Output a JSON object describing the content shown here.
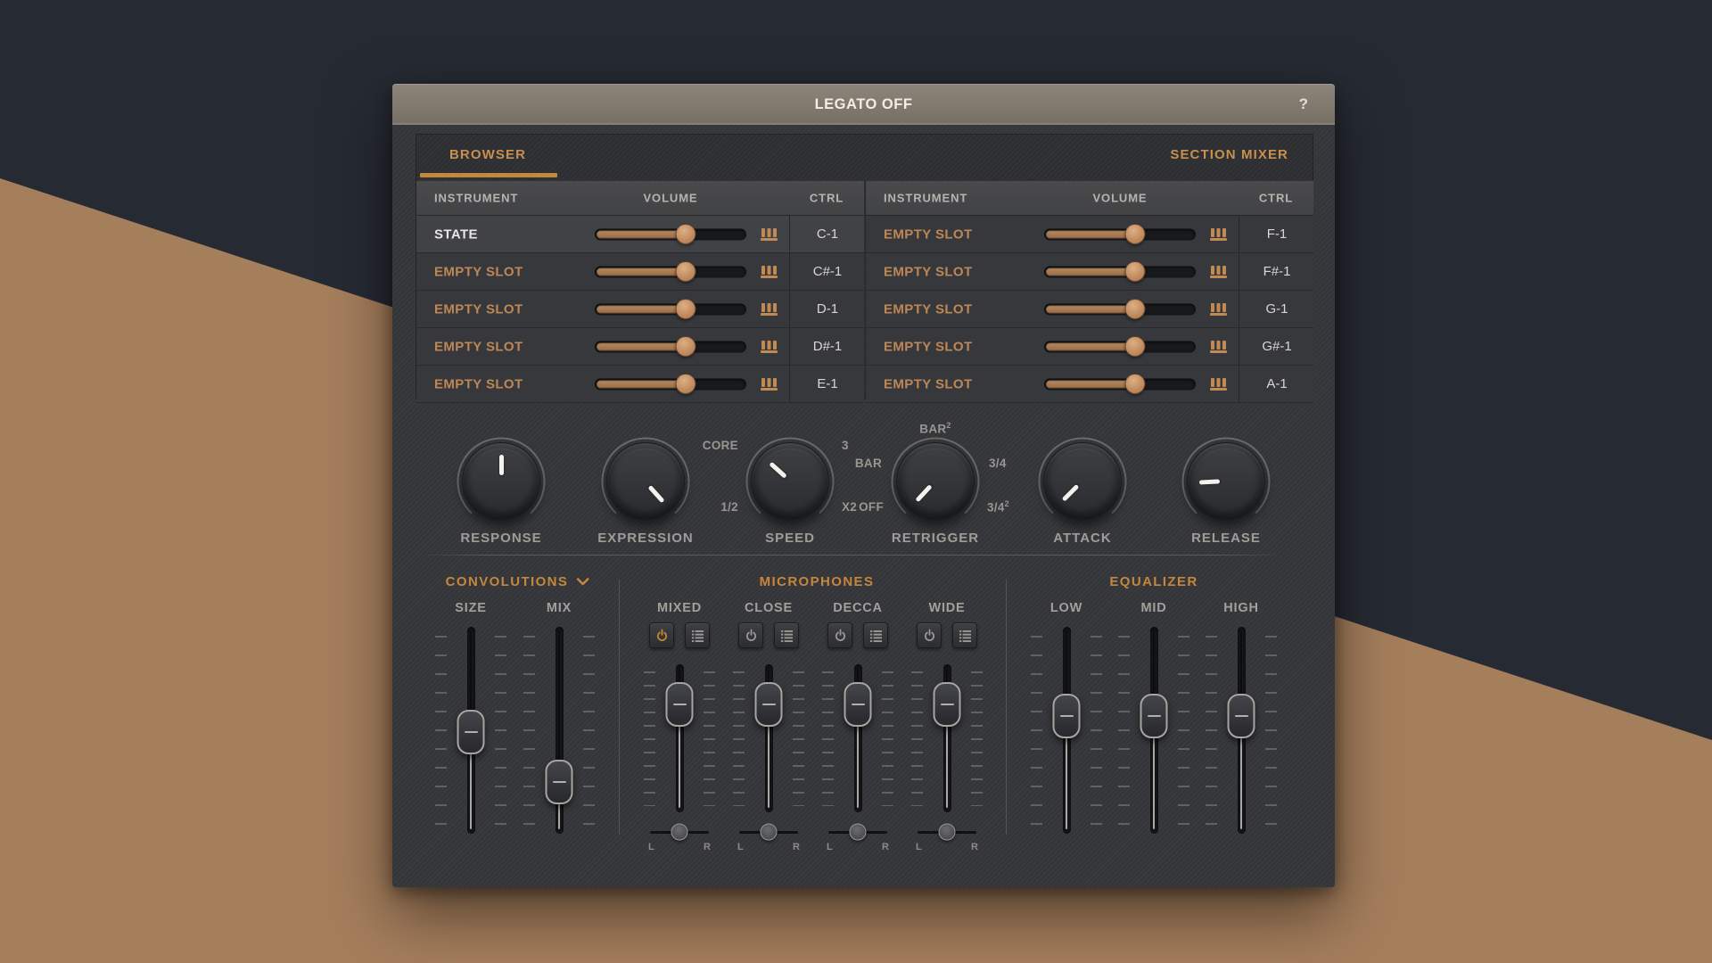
{
  "colors": {
    "accent_orange": "#C5873E",
    "empty_slot_orange": "#BE8757",
    "desktop_navy": "#262A32",
    "desktop_tan": "#A57E5C",
    "slider_fill": "#A87A52"
  },
  "window": {
    "title": "LEGATO OFF",
    "help": "?",
    "tabs": {
      "browser": "BROWSER",
      "section_mixer": "SECTION MIXER"
    }
  },
  "browser_table": {
    "columns": {
      "instrument": "INSTRUMENT",
      "volume": "VOLUME",
      "ctrl": "CTRL"
    },
    "left_rows": [
      {
        "instrument": "STATE",
        "ctrl": "C-1",
        "volume": 60,
        "loaded": true
      },
      {
        "instrument": "EMPTY SLOT",
        "ctrl": "C#-1",
        "volume": 60,
        "loaded": false
      },
      {
        "instrument": "EMPTY SLOT",
        "ctrl": "D-1",
        "volume": 60,
        "loaded": false
      },
      {
        "instrument": "EMPTY SLOT",
        "ctrl": "D#-1",
        "volume": 60,
        "loaded": false
      },
      {
        "instrument": "EMPTY SLOT",
        "ctrl": "E-1",
        "volume": 60,
        "loaded": false
      }
    ],
    "right_rows": [
      {
        "instrument": "EMPTY SLOT",
        "ctrl": "F-1",
        "volume": 60,
        "loaded": false
      },
      {
        "instrument": "EMPTY SLOT",
        "ctrl": "F#-1",
        "volume": 60,
        "loaded": false
      },
      {
        "instrument": "EMPTY SLOT",
        "ctrl": "G-1",
        "volume": 60,
        "loaded": false
      },
      {
        "instrument": "EMPTY SLOT",
        "ctrl": "G#-1",
        "volume": 60,
        "loaded": false
      },
      {
        "instrument": "EMPTY SLOT",
        "ctrl": "A-1",
        "volume": 60,
        "loaded": false
      }
    ]
  },
  "knobs": [
    {
      "label": "RESPONSE",
      "angle": 0
    },
    {
      "label": "EXPRESSION",
      "angle": 138
    },
    {
      "label": "SPEED",
      "angle": -48,
      "marks": {
        "tl": "CORE",
        "tr": "3",
        "bl": "1/2",
        "br": "X2"
      }
    },
    {
      "label": "RETRIGGER",
      "angle": -137,
      "marks": {
        "top": "BAR",
        "top_sup": "2",
        "left": "BAR",
        "right": "3/4",
        "bl": "OFF",
        "br": "3/4",
        "br_sup": "2"
      }
    },
    {
      "label": "ATTACK",
      "angle": -135
    },
    {
      "label": "RELEASE",
      "angle": -93
    }
  ],
  "convolutions": {
    "title": "CONVOLUTIONS",
    "faders": [
      {
        "label": "SIZE",
        "value": 51
      },
      {
        "label": "MIX",
        "value": 75
      }
    ]
  },
  "microphones": {
    "title": "MICROPHONES",
    "pan_l": "L",
    "pan_r": "R",
    "channels": [
      {
        "label": "MIXED",
        "power_on": true,
        "fader": 27,
        "pan": 50
      },
      {
        "label": "CLOSE",
        "power_on": false,
        "fader": 27,
        "pan": 50
      },
      {
        "label": "DECCA",
        "power_on": false,
        "fader": 27,
        "pan": 50
      },
      {
        "label": "WIDE",
        "power_on": false,
        "fader": 27,
        "pan": 50
      }
    ]
  },
  "equalizer": {
    "title": "EQUALIZER",
    "faders": [
      {
        "label": "LOW",
        "value": 43
      },
      {
        "label": "MID",
        "value": 43
      },
      {
        "label": "HIGH",
        "value": 43
      }
    ]
  }
}
